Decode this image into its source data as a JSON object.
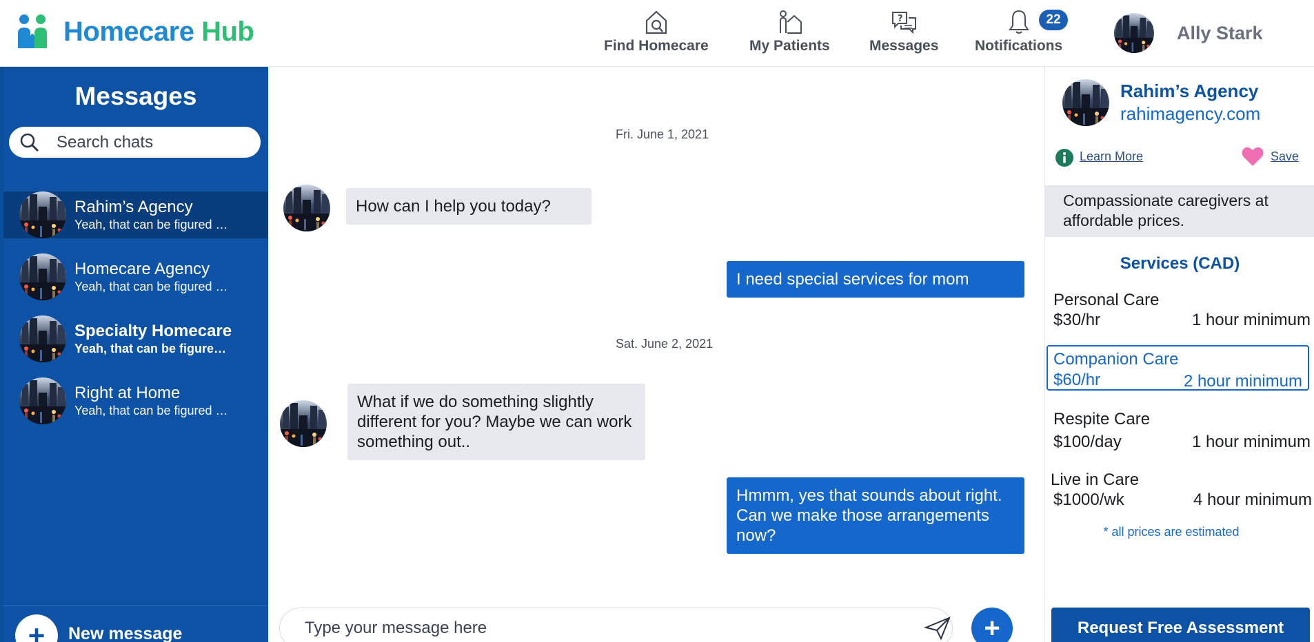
{
  "brand": {
    "name_part1": "Homecare",
    "name_part2": "Hub",
    "color_primary": "#1f8ad3",
    "color_secondary": "#2dbf75"
  },
  "nav": {
    "items": [
      {
        "label": "Find Homecare",
        "icon": "house-search-icon"
      },
      {
        "label": "My Patients",
        "icon": "person-house-icon"
      },
      {
        "label": "Messages",
        "icon": "chat-bubbles-icon"
      },
      {
        "label": "Notifications",
        "icon": "bell-icon",
        "badge": "22"
      }
    ],
    "user_name": "Ally Stark"
  },
  "sidebar": {
    "title": "Messages",
    "search_placeholder": "Search chats",
    "chats": [
      {
        "name": "Rahim’s Agency",
        "preview": "Yeah, that can be figured …",
        "active": true
      },
      {
        "name": "Homecare Agency",
        "preview": "Yeah, that can be figured …"
      },
      {
        "name": "Specialty Homecare",
        "preview": "Yeah, that can be figure…",
        "unread": true
      },
      {
        "name": "Right at Home",
        "preview": "Yeah, that can be figured …"
      }
    ],
    "new_message_label": "New message",
    "bg_color": "#0d52a4"
  },
  "conversation": {
    "dates": [
      "Fri. June 1, 2021",
      "Sat. June 2, 2021"
    ],
    "messages": [
      {
        "direction": "in",
        "text": "How can I help you today?"
      },
      {
        "direction": "out",
        "text": "I need special services for mom"
      },
      {
        "direction": "in",
        "text": "What if we do something slightly different for you? Maybe we can work something out.."
      },
      {
        "direction": "out",
        "text": "Hmmm, yes that sounds about right. Can we make those arrangements now?"
      }
    ],
    "composer_placeholder": "Type your message here"
  },
  "agency": {
    "name": "Rahim’s Agency",
    "website": "rahimagency.com",
    "learn_more": "Learn More",
    "save": "Save",
    "tagline": "Compassionate caregivers at affordable prices.",
    "services_title": "Services (CAD)",
    "services": [
      {
        "name": "Personal Care",
        "price": "$30/hr",
        "minimum": "1 hour minimum"
      },
      {
        "name": "Companion Care",
        "price": "$60/hr",
        "minimum": "2 hour minimum",
        "selected": true
      },
      {
        "name": "Respite Care",
        "price": "$100/day",
        "minimum": "1 hour minimum"
      },
      {
        "name": "Live in Care",
        "price": "$1000/wk",
        "minimum": "4 hour minimum"
      }
    ],
    "note": "* all prices are estimated",
    "request_button": "Request Free Assessment"
  }
}
